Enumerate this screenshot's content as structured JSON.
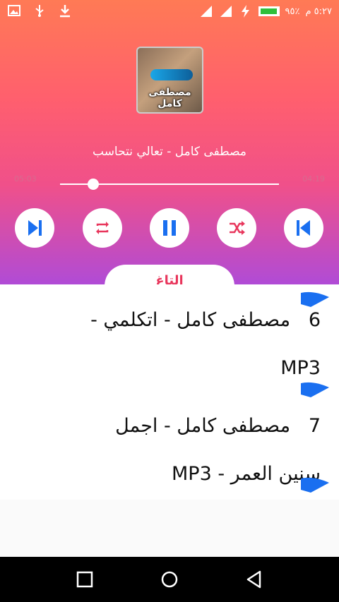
{
  "status_bar": {
    "time": "٥:٢٧ م",
    "battery_percent": "٩٥٪",
    "left_icons": [
      "image-icon",
      "usb-icon",
      "download-icon"
    ],
    "right_icons": [
      "signal-icon",
      "signal-icon",
      "charging-icon",
      "battery-icon"
    ]
  },
  "player": {
    "cover_caption": "مصطفى كامل",
    "song_title": "مصطفى كامل - تعالي نتحاسب",
    "elapsed": "05:03",
    "duration": "04:19",
    "progress_fraction": 0.15,
    "controls": [
      "next-icon",
      "repeat-icon",
      "pause-icon",
      "shuffle-icon",
      "previous-icon"
    ],
    "tab_label": "التاغ"
  },
  "playlist": [
    {
      "number": "6",
      "title_line1": "مصطفى كامل - اتكلمي -",
      "title_line2": "MP3"
    },
    {
      "number": "7",
      "title_line1": "مصطفى كامل - اجمل",
      "title_line2": "سنين العمر - MP3"
    }
  ],
  "colors": {
    "accent_blue": "#1a6ff0",
    "gradient_top": "#ff7a55",
    "gradient_bottom": "#b04bd6",
    "seek_text": "#d76b8f"
  },
  "navbar": [
    "recents-icon",
    "home-icon",
    "back-icon"
  ]
}
